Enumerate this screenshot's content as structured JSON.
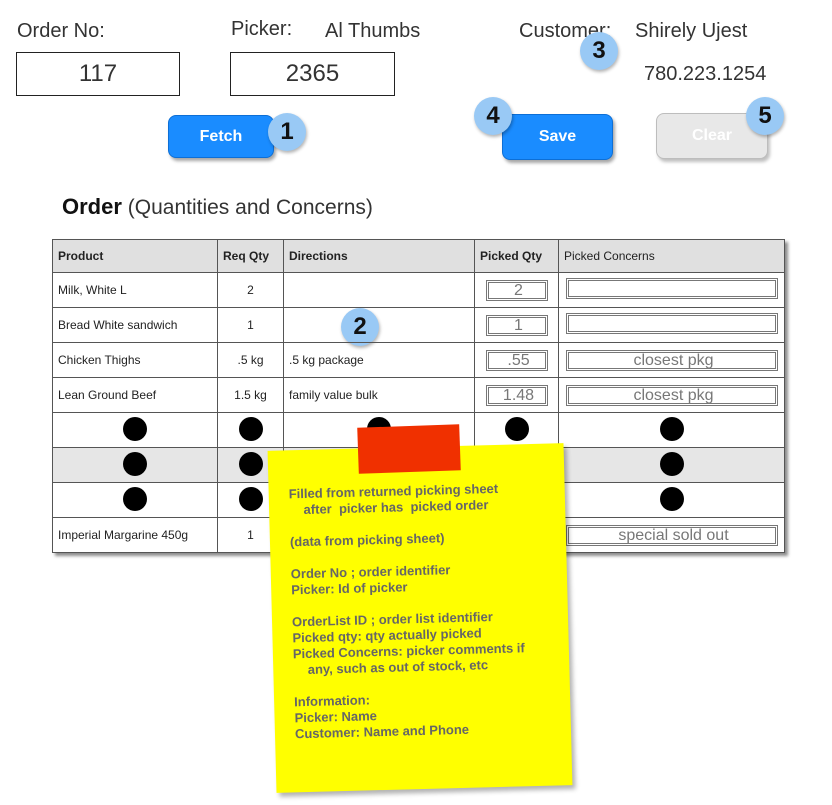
{
  "header": {
    "order_no_label": "Order No:",
    "order_no_value": "117",
    "picker_label": "Picker:",
    "picker_name": "Al Thumbs",
    "picker_id_value": "2365",
    "customer_label": "Customer:",
    "customer_name": "Shirely Ujest",
    "customer_phone": "780.223.1254"
  },
  "buttons": {
    "fetch": "Fetch",
    "save": "Save",
    "clear": "Clear"
  },
  "badges": [
    "1",
    "2",
    "3",
    "4",
    "5"
  ],
  "section": {
    "title_bold": "Order",
    "title_rest": "(Quantities and Concerns)"
  },
  "table": {
    "headers": [
      "Product",
      "Req Qty",
      "Directions",
      "Picked Qty",
      "Picked Concerns"
    ],
    "rows": [
      {
        "product": "Milk, White L",
        "req": "2",
        "directions": "",
        "picked": "2",
        "concern": ""
      },
      {
        "product": "Bread White sandwich",
        "req": "1",
        "directions": "",
        "picked": "1",
        "concern": ""
      },
      {
        "product": "Chicken Thighs",
        "req": ".5 kg",
        "directions": ".5 kg package",
        "picked": ".55",
        "concern": "closest pkg"
      },
      {
        "product": "Lean Ground Beef",
        "req": "1.5 kg",
        "directions": "family value bulk",
        "picked": "1.48",
        "concern": "closest pkg"
      },
      {
        "product": "Imperial Margarine 450g",
        "req": "1",
        "directions": "",
        "picked": "",
        "concern": "special sold out"
      }
    ]
  },
  "note": {
    "text": "Filled from returned picking sheet\n    after  picker has  picked order\n\n(data from picking sheet)\n\nOrder No ; order identifier\nPicker: Id of picker\n\nOrderList ID ; order list identifier\nPicked qty: qty actually picked\nPicked Concerns: picker comments if\n    any, such as out of stock, etc\n\nInformation:\nPicker: Name\nCustomer: Name and Phone",
    "color": "#ffff00",
    "tape_color": "#f03000"
  },
  "colors": {
    "accent": "#1a8cff",
    "badge": "#99c9f5",
    "disabled": "#e8e8e8"
  }
}
